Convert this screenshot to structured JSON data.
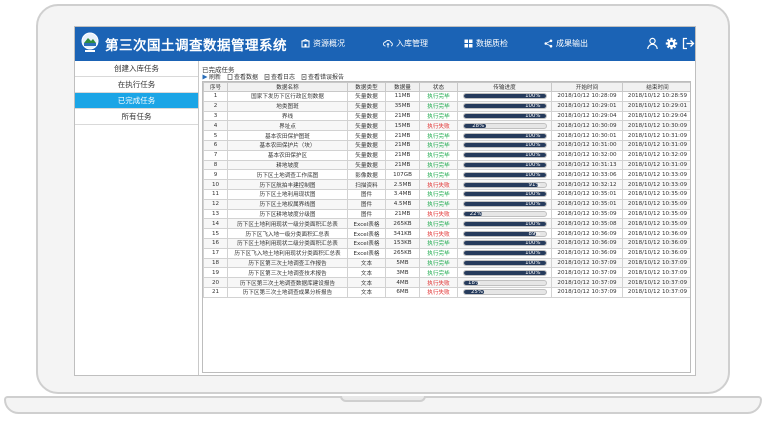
{
  "app": {
    "title": "第三次国土调查数据管理系统",
    "colors": {
      "header": "#1b63b5",
      "active": "#1ba5e6",
      "progress": "#263b5c",
      "ok": "#19a94a",
      "fail": "#e12c2c"
    }
  },
  "nav": [
    {
      "label": "资源概况",
      "icon": "building-icon"
    },
    {
      "label": "入库管理",
      "icon": "cloud-upload-icon"
    },
    {
      "label": "数据质检",
      "icon": "grid-icon"
    },
    {
      "label": "成果输出",
      "icon": "share-icon"
    }
  ],
  "header_icons": [
    "user-icon",
    "gear-icon",
    "logout-icon"
  ],
  "sidebar": {
    "items": [
      {
        "label": "创建入库任务"
      },
      {
        "label": "在执行任务"
      },
      {
        "label": "已完成任务",
        "active": true
      },
      {
        "label": "所有任务"
      }
    ]
  },
  "content": {
    "section_title": "已完成任务",
    "toolbar": {
      "refresh": "刷新",
      "view_data": "查看数据",
      "view_log": "查看日志",
      "view_error_report": "查看错误报告"
    }
  },
  "table": {
    "columns": [
      "序号",
      "数据名称",
      "数据类型",
      "数据量",
      "状态",
      "传输进度",
      "开始时间",
      "结束时间"
    ],
    "rows": [
      {
        "no": "1",
        "name": "国家下发历下区行政区划数据",
        "type": "矢量数据",
        "size": "11MB",
        "status": "执行完毕",
        "ok": true,
        "progress": "100%",
        "pct": 100,
        "start": "2018/10/12 10:28:09",
        "end": "2018/10/12 10:28:59"
      },
      {
        "no": "2",
        "name": "地类图斑",
        "type": "矢量数据",
        "size": "35MB",
        "status": "执行完毕",
        "ok": true,
        "progress": "100%",
        "pct": 100,
        "start": "2018/10/12 10:29:01",
        "end": "2018/10/12 10:29:01"
      },
      {
        "no": "3",
        "name": "界线",
        "type": "矢量数据",
        "size": "21MB",
        "status": "执行完毕",
        "ok": true,
        "progress": "100%",
        "pct": 100,
        "start": "2018/10/12 10:29:04",
        "end": "2018/10/12 10:29:04"
      },
      {
        "no": "4",
        "name": "界址点",
        "type": "矢量数据",
        "size": "15MB",
        "status": "执行失败",
        "ok": false,
        "progress": "28%",
        "pct": 28,
        "start": "2018/10/12 10:30:09",
        "end": "2018/10/12 10:30:09"
      },
      {
        "no": "5",
        "name": "基本农田保护图斑",
        "type": "矢量数据",
        "size": "21MB",
        "status": "执行完毕",
        "ok": true,
        "progress": "100%",
        "pct": 100,
        "start": "2018/10/12 10:30:01",
        "end": "2018/10/12 10:31:09"
      },
      {
        "no": "6",
        "name": "基本农田保护片（块）",
        "type": "矢量数据",
        "size": "21MB",
        "status": "执行完毕",
        "ok": true,
        "progress": "100%",
        "pct": 100,
        "start": "2018/10/12 10:31:00",
        "end": "2018/10/12 10:31:09"
      },
      {
        "no": "7",
        "name": "基本农田保护区",
        "type": "矢量数据",
        "size": "21MB",
        "status": "执行完毕",
        "ok": true,
        "progress": "100%",
        "pct": 100,
        "start": "2018/10/12 10:32:00",
        "end": "2018/10/12 10:32:09"
      },
      {
        "no": "8",
        "name": "耕地坡度",
        "type": "矢量数据",
        "size": "21MB",
        "status": "执行完毕",
        "ok": true,
        "progress": "100%",
        "pct": 100,
        "start": "2018/10/12 10:31:13",
        "end": "2018/10/12 10:31:09"
      },
      {
        "no": "9",
        "name": "历下区土地调查工作底图",
        "type": "影像数据",
        "size": "107GB",
        "status": "执行完毕",
        "ok": true,
        "progress": "100%",
        "pct": 100,
        "start": "2018/10/12 10:33:06",
        "end": "2018/10/12 10:33:09"
      },
      {
        "no": "10",
        "name": "历下区航拍丰建控制图",
        "type": "扫描资料",
        "size": "2.5MB",
        "status": "执行失败",
        "ok": false,
        "progress": "91%",
        "pct": 91,
        "start": "2018/10/12 10:32:12",
        "end": "2018/10/12 10:33:09"
      },
      {
        "no": "11",
        "name": "历下区土地利用现状图",
        "type": "图件",
        "size": "3.4MB",
        "status": "执行完毕",
        "ok": true,
        "progress": "100%",
        "pct": 100,
        "start": "2018/10/12 10:35:01",
        "end": "2018/10/12 10:35:09"
      },
      {
        "no": "12",
        "name": "历下区土地权属界线图",
        "type": "图件",
        "size": "4.5MB",
        "status": "执行完毕",
        "ok": true,
        "progress": "100%",
        "pct": 100,
        "start": "2018/10/12 10:35:01",
        "end": "2018/10/12 10:35:09"
      },
      {
        "no": "13",
        "name": "历下区耕地坡度分级图",
        "type": "图件",
        "size": "21MB",
        "status": "执行失败",
        "ok": false,
        "progress": "22%",
        "pct": 22,
        "start": "2018/10/12 10:35:09",
        "end": "2018/10/12 10:35:09"
      },
      {
        "no": "14",
        "name": "历下区土地利用现状一级分类面积汇总表",
        "type": "Excel表格",
        "size": "265KB",
        "status": "执行完毕",
        "ok": true,
        "progress": "100%",
        "pct": 100,
        "start": "2018/10/12 10:35:08",
        "end": "2018/10/12 10:35:09"
      },
      {
        "no": "15",
        "name": "历下区飞入地一级分类面积汇总表",
        "type": "Excel表格",
        "size": "341KB",
        "status": "执行失败",
        "ok": false,
        "progress": "89%",
        "pct": 89,
        "start": "2018/10/12 10:36:09",
        "end": "2018/10/12 10:36:09"
      },
      {
        "no": "16",
        "name": "历下区土地利用现状二级分类面积汇总表",
        "type": "Excel表格",
        "size": "153KB",
        "status": "执行完毕",
        "ok": true,
        "progress": "100%",
        "pct": 100,
        "start": "2018/10/12 10:36:09",
        "end": "2018/10/12 10:36:09"
      },
      {
        "no": "17",
        "name": "历下区飞入地土地利用现状分类面积汇总表",
        "type": "Excel表格",
        "size": "265KB",
        "status": "执行完毕",
        "ok": true,
        "progress": "100%",
        "pct": 100,
        "start": "2018/10/12 10:36:09",
        "end": "2018/10/12 10:36:09"
      },
      {
        "no": "18",
        "name": "历下区第三次土地调查工作报告",
        "type": "文本",
        "size": "5MB",
        "status": "执行完毕",
        "ok": true,
        "progress": "100%",
        "pct": 100,
        "start": "2018/10/12 10:37:09",
        "end": "2018/10/12 10:37:09"
      },
      {
        "no": "19",
        "name": "历下区第三次土地调查技术报告",
        "type": "文本",
        "size": "3MB",
        "status": "执行完毕",
        "ok": true,
        "progress": "100%",
        "pct": 100,
        "start": "2018/10/12 10:37:09",
        "end": "2018/10/12 10:37:09"
      },
      {
        "no": "20",
        "name": "历下区第三次土地调查数据库建设报告",
        "type": "文本",
        "size": "4MB",
        "status": "执行失败",
        "ok": false,
        "progress": "18%",
        "pct": 18,
        "start": "2018/10/12 10:37:09",
        "end": "2018/10/12 10:37:09"
      },
      {
        "no": "21",
        "name": "历下区第三次土地调查成果分析报告",
        "type": "文本",
        "size": "6MB",
        "status": "执行失败",
        "ok": false,
        "progress": "25%",
        "pct": 25,
        "start": "2018/10/12 10:37:09",
        "end": "2018/10/12 10:37:09"
      }
    ]
  }
}
